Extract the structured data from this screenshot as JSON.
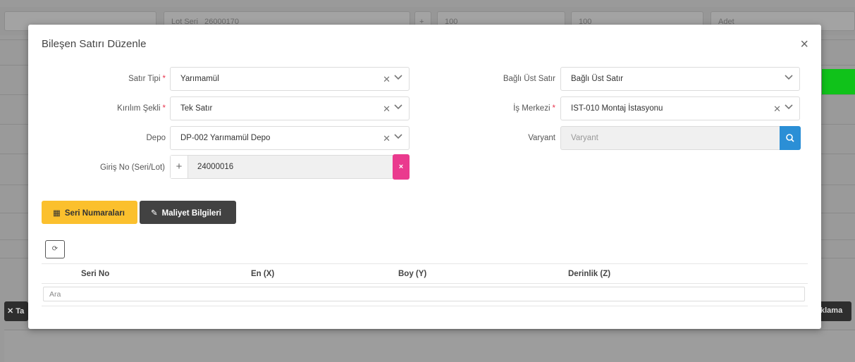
{
  "background": {
    "top_fields": [
      "Lot Seri",
      "26000170",
      "+",
      "100",
      "100",
      "Adet"
    ],
    "left_button_label": "Ta",
    "right_button_label": "klama"
  },
  "modal": {
    "title": "Bileşen Satırı Düzenle",
    "close_icon": "close-icon",
    "left_fields": [
      {
        "label": "Satır Tipi",
        "required": true,
        "value": "Yarımamül"
      },
      {
        "label": "Kırılım Şekli",
        "required": true,
        "value": "Tek Satır"
      },
      {
        "label": "Depo",
        "required": false,
        "value": "DP-002 Yarımamül Depo"
      }
    ],
    "right_fields": [
      {
        "label": "Bağlı Üst Satır",
        "required": false,
        "value": "Bağlı Üst Satır"
      },
      {
        "label": "İş Merkezi",
        "required": true,
        "value": "IST-010 Montaj İstasyonu"
      },
      {
        "label": "Varyant",
        "required": false,
        "placeholder": "Varyant"
      }
    ],
    "entry": {
      "label": "Giriş No (Seri/Lot)",
      "plus": "+",
      "value": "24000016",
      "clear": "×"
    },
    "tabs": {
      "serial_numbers": "Seri Numaraları",
      "cost_info": "Maliyet Bilgileri"
    },
    "table": {
      "columns": [
        "Seri No",
        "En (X)",
        "Boy (Y)",
        "Derinlik (Z)"
      ],
      "filter_placeholder": "Ara"
    }
  },
  "colors": {
    "accent_yellow": "#fbc02d",
    "dark_button": "#424242",
    "search_blue": "#2b8fd6",
    "clear_pink": "#ea3a8e",
    "required_red": "#e8344d",
    "status_green": "#10c21a"
  }
}
